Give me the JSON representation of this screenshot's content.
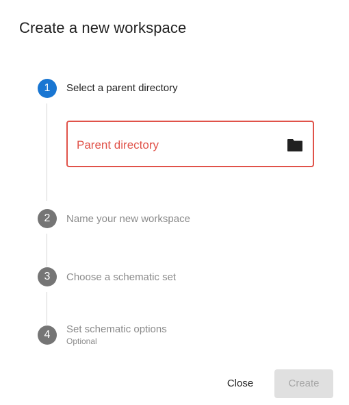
{
  "dialog": {
    "title": "Create a new workspace"
  },
  "steps": [
    {
      "number": "1",
      "label": "Select a parent directory",
      "state": "active"
    },
    {
      "number": "2",
      "label": "Name your new workspace",
      "state": "inactive"
    },
    {
      "number": "3",
      "label": "Choose a schematic set",
      "state": "inactive"
    },
    {
      "number": "4",
      "label": "Set schematic options",
      "sublabel": "Optional",
      "state": "inactive"
    }
  ],
  "parent_directory_field": {
    "label": "Parent directory",
    "icon": "folder-icon",
    "state": "error"
  },
  "actions": {
    "close_label": "Close",
    "create_label": "Create",
    "create_enabled": false
  },
  "colors": {
    "accent": "#1976d2",
    "error": "#e05249",
    "inactive_step": "#757575",
    "disabled_button_bg": "#e0e0e0"
  }
}
